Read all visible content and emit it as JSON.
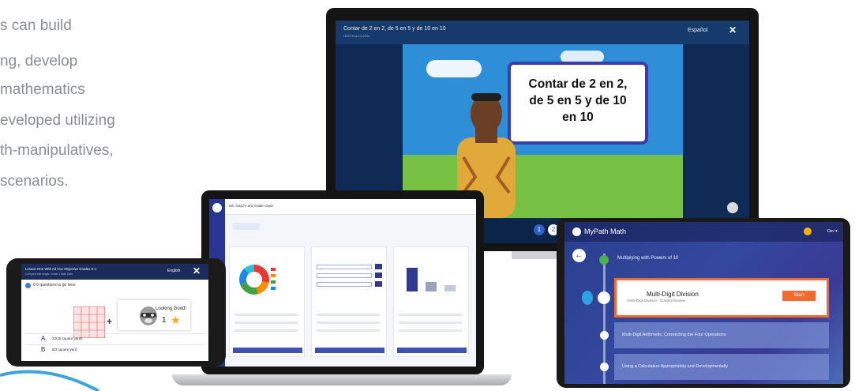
{
  "intro": {
    "lines": [
      "s can build",
      "ng, develop",
      "mathematics",
      "eveloped utilizing",
      "th-manipulatives,",
      "scenarios."
    ]
  },
  "monitor": {
    "lesson_title": "Contar de 2 en 2, de 5 en 5 y de 10 en 10",
    "lesson_subtitle": "INSTRUCCIÓN",
    "language": "Español",
    "close": "✕",
    "board_text": "Contar de 2 en 2,\nde 5 en 5 y de 10\nen 10",
    "pages": [
      "1",
      "2"
    ]
  },
  "laptop": {
    "class_name": "Ms. Ganz's 3rd Grade Class"
  },
  "phone": {
    "lesson_title": "Lesson One With Ad Hoc Objective Grades K-1",
    "lesson_sub": "Compare with length, Grade 1 Math Data",
    "language": "English",
    "close": "✕",
    "question": "0 0 questions to go here",
    "card_text": "Looking Good!",
    "card_count": "1",
    "option_a_letter": "A",
    "option_a_text": "20/25 square yards",
    "option_b_letter": "B",
    "option_b_text": "8/3 square yard"
  },
  "tablet": {
    "brand": "MyPath Math",
    "user": "Dev ▾",
    "back": "←",
    "section": "Multiplying with Powers of 10",
    "current_title": "Multi-Digit Division",
    "current_sub": "Multi-Digit Division · Content Review",
    "start": "Start",
    "card2": "Multi-Digit Arithmetic: Connecting the Four Operations",
    "card3": "Using a Calculation Appropriately and Developmentally"
  },
  "colors": {
    "accent_blue": "#2f5fc6",
    "orange": "#f26b2e",
    "swoosh": "#3fa4dd"
  }
}
